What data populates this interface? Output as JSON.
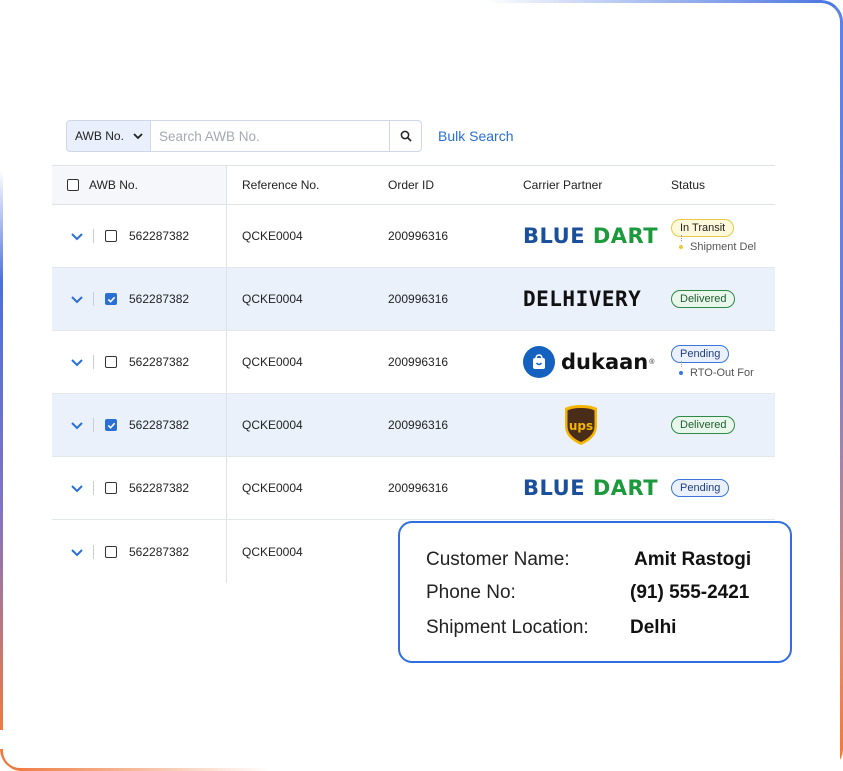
{
  "search": {
    "filter_label": "AWB No.",
    "placeholder": "Search AWB No.",
    "bulk_label": "Bulk Search"
  },
  "table": {
    "headers": {
      "awb": "AWB No.",
      "reference": "Reference No.",
      "order": "Order ID",
      "carrier": "Carrier Partner",
      "status": "Status"
    },
    "rows": [
      {
        "awb": "562287382",
        "ref": "QCKE0004",
        "order": "200996316",
        "carrier": "BLUE DART",
        "status": "In Transit",
        "sub_status": "Shipment Del",
        "checked": false
      },
      {
        "awb": "562287382",
        "ref": "QCKE0004",
        "order": "200996316",
        "carrier": "DELHIVERY",
        "status": "Delivered",
        "sub_status": "",
        "checked": true
      },
      {
        "awb": "562287382",
        "ref": "QCKE0004",
        "order": "200996316",
        "carrier": "dukaan",
        "status": "Pending",
        "sub_status": "RTO-Out For",
        "checked": false
      },
      {
        "awb": "562287382",
        "ref": "QCKE0004",
        "order": "200996316",
        "carrier": "ups",
        "status": "Delivered",
        "sub_status": "",
        "checked": true
      },
      {
        "awb": "562287382",
        "ref": "QCKE0004",
        "order": "200996316",
        "carrier": "BLUE DART",
        "status": "Pending",
        "sub_status": "",
        "checked": false
      },
      {
        "awb": "562287382",
        "ref": "QCKE0004",
        "order": "",
        "carrier": "",
        "status": "",
        "sub_status": "",
        "checked": false
      }
    ]
  },
  "logos": {
    "bluedart_blue": "BLUE",
    "bluedart_green": "DART",
    "delhivery": "DELHIVERY",
    "dukaan": "dukaan",
    "ups": "ups"
  },
  "customer_card": {
    "name_label": "Customer Name:",
    "name_value": "Amit Rastogi",
    "phone_label": "Phone No:",
    "phone_value": "(91) 555-2421",
    "location_label": "Shipment Location:",
    "location_value": "Delhi"
  },
  "colors": {
    "accent": "#2a6fd6",
    "selected_row": "#eaf1fb",
    "card_border": "#2f6fe0",
    "bluedart_blue": "#1a4f9c",
    "bluedart_green": "#1b9a3c"
  }
}
